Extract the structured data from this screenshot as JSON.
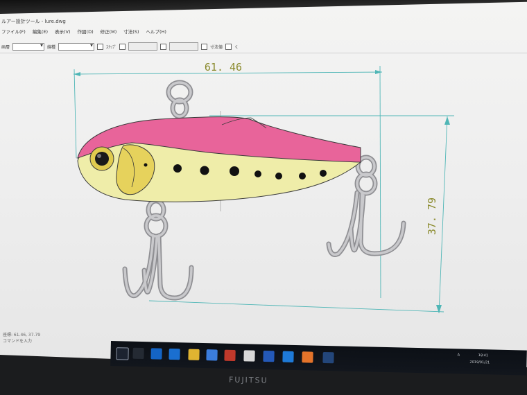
{
  "window": {
    "title": "ルアー設計ツール - lure.dwg",
    "menu": [
      "ファイル(F)",
      "編集(E)",
      "表示(V)",
      "作図(D)",
      "修正(M)",
      "寸法(S)",
      "ヘルプ(H)"
    ]
  },
  "toolbar": {
    "layer_label": "画層",
    "linetype_label": "線種",
    "dim_label": "寸法",
    "check1_label": "ｽﾅｯﾌﾟ",
    "check2_label": "寸法値",
    "check3_label": "く"
  },
  "drawing": {
    "width_dimension": "61. 46",
    "height_dimension": "37. 79",
    "body_colors": {
      "back": "#e8649a",
      "belly": "#efeda9",
      "gill": "#e6d25c",
      "hooks": "#b8b8bc"
    },
    "spot_count": 8
  },
  "status": {
    "line1": "座標: 61.46, 37.79",
    "line2": "コマンドを入力"
  },
  "taskbar": {
    "clock_time": "18:41",
    "clock_date": "2019/01/21",
    "ime": "A",
    "icons": [
      "start-icon",
      "search-icon",
      "task-view-icon",
      "edge-icon",
      "ie-icon",
      "explorer-icon",
      "store-icon",
      "media-icon",
      "mail-icon",
      "app-icon",
      "ie2-icon",
      "paint-icon",
      "java-icon"
    ]
  },
  "monitor": {
    "brand": "FUJITSU"
  }
}
